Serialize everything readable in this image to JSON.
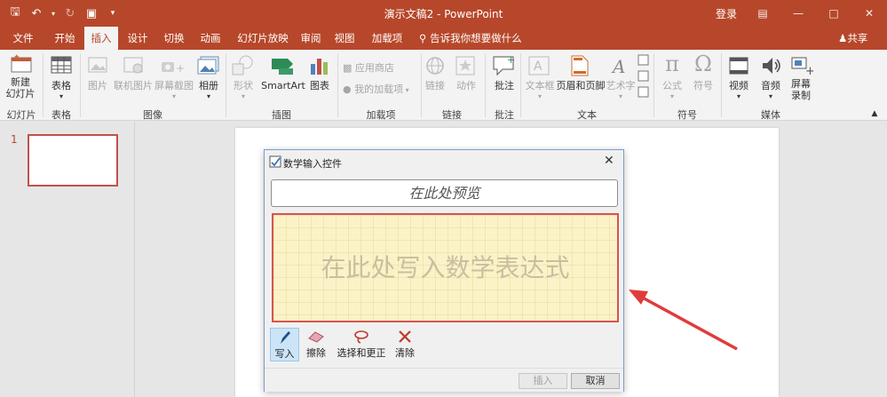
{
  "title_bar": {
    "title": "演示文稿2 - PowerPoint",
    "login": "登录"
  },
  "tabs": [
    "文件",
    "开始",
    "插入",
    "设计",
    "切换",
    "动画",
    "幻灯片放映",
    "审阅",
    "视图",
    "加载项"
  ],
  "active_tab": "插入",
  "tell_me": "告诉我你想要做什么",
  "share": "共享",
  "ribbon": {
    "new_slide": "新建\n幻灯片",
    "table": "表格",
    "picture": "图片",
    "online_picture": "联机图片",
    "screenshot": "屏幕截图",
    "album": "相册",
    "shapes": "形状",
    "smartart": "SmartArt",
    "chart": "图表",
    "app_store": "应用商店",
    "my_addins": "我的加载项",
    "link": "链接",
    "action": "动作",
    "comment": "批注",
    "textbox": "文本框",
    "header_footer": "页眉和页脚",
    "wordart": "艺术字",
    "equation": "公式",
    "symbol": "符号",
    "video": "视频",
    "audio": "音频",
    "screen_record": "屏幕\n录制",
    "groups": {
      "slides": "幻灯片",
      "tables": "表格",
      "images": "图像",
      "illustrations": "插图",
      "addins": "加载项",
      "links": "链接",
      "comments": "批注",
      "text": "文本",
      "symbols": "符号",
      "media": "媒体"
    }
  },
  "slide_pane": {
    "slide_number": "1"
  },
  "dialog": {
    "title": "数学输入控件",
    "preview_placeholder": "在此处预览",
    "write_placeholder": "在此处写入数学表达式",
    "tools": [
      "写入",
      "擦除",
      "选择和更正",
      "清除"
    ],
    "active_tool": "写入",
    "insert_button": "插入",
    "cancel_button": "取消"
  },
  "colors": {
    "accent": "#b7472a",
    "highlight_border": "#d9534f",
    "arrow": "#e03c3c"
  }
}
